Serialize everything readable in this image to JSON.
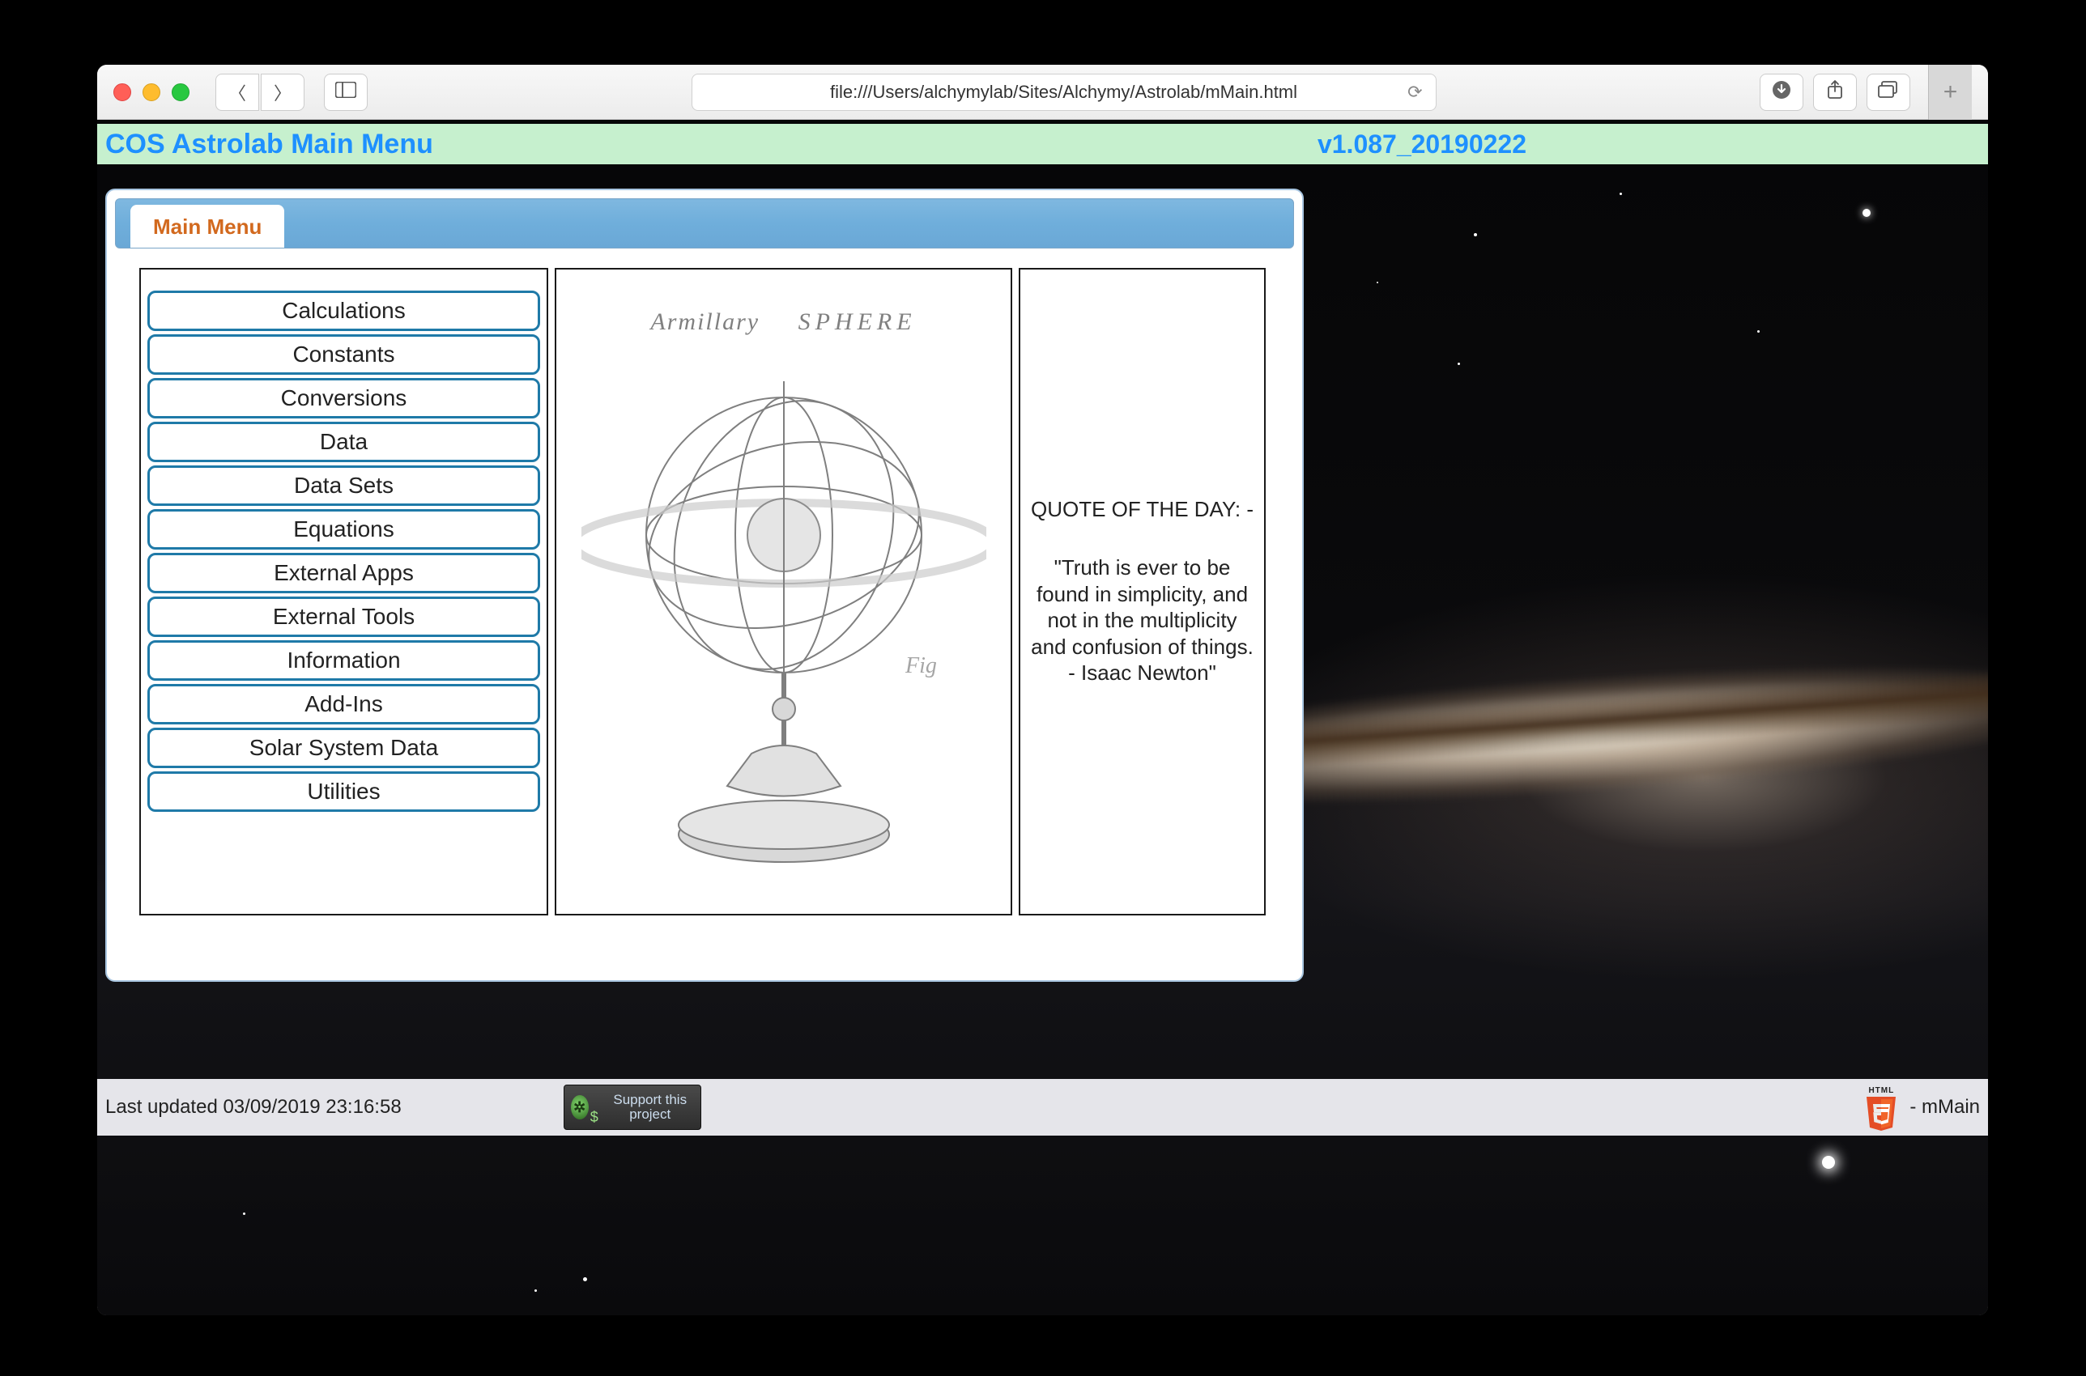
{
  "browser": {
    "url": "file:///Users/alchymylab/Sites/Alchymy/Astrolab/mMain.html"
  },
  "header": {
    "title": "COS Astrolab Main Menu",
    "version": "v1.087_20190222"
  },
  "tab": {
    "label": "Main Menu"
  },
  "menu": {
    "items": [
      "Calculations",
      "Constants",
      "Conversions",
      "Data",
      "Data Sets",
      "Equations",
      "External Apps",
      "External Tools",
      "Information",
      "Add-Ins",
      "Solar System Data",
      "Utilities"
    ]
  },
  "center_image": {
    "caption_left": "Armillary",
    "caption_right": "SPHERE",
    "fig_label": "Fig"
  },
  "quote": {
    "heading": "QUOTE OF THE DAY: -",
    "body": "\"Truth is ever to be found in simplicity, and not in the multiplicity and confusion of things. - Isaac Newton\""
  },
  "footer": {
    "updated": "Last updated 03/09/2019 23:16:58",
    "support_label": "Support this project",
    "html5_small": "HTML",
    "page_name": "- mMain"
  },
  "colors": {
    "header_bg": "#c6f0ce",
    "accent_blue": "#1e90ff",
    "button_border": "#1f7aa8",
    "tab_text": "#d2691e"
  }
}
